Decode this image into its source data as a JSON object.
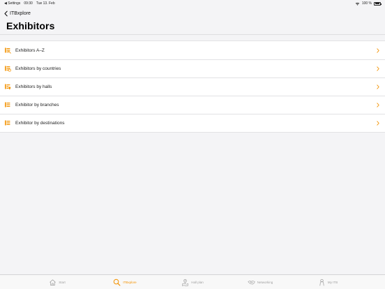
{
  "status_bar": {
    "back_app": "◀ Settings",
    "time": "09:30",
    "date": "Tue 13. Feb",
    "battery": "100 %"
  },
  "nav": {
    "back_label": "ITBxplore",
    "title": "Exhibitors"
  },
  "list": {
    "items": [
      {
        "label": "Exhibitors A–Z",
        "icon": "alphabet-list-icon"
      },
      {
        "label": "Exhibitors by countries",
        "icon": "countries-list-icon"
      },
      {
        "label": "Exhibitors by halls",
        "icon": "halls-pin-icon"
      },
      {
        "label": "Exhibitor by branches",
        "icon": "branches-list-icon"
      },
      {
        "label": "Exhibitor by destinations",
        "icon": "destinations-list-icon"
      }
    ]
  },
  "tabs": [
    {
      "label": "Start",
      "icon": "home-icon",
      "active": false
    },
    {
      "label": "ITBxplore",
      "icon": "search-icon",
      "active": true
    },
    {
      "label": "Hall plan",
      "icon": "hall-plan-icon",
      "active": false
    },
    {
      "label": "Networking",
      "icon": "handshake-icon",
      "active": false
    },
    {
      "label": "My ITB",
      "icon": "person-icon",
      "active": false
    }
  ],
  "colors": {
    "accent": "#f39200",
    "inactive": "#a0a0a0",
    "background": "#f4f4f6",
    "list_bg": "#ffffff"
  }
}
